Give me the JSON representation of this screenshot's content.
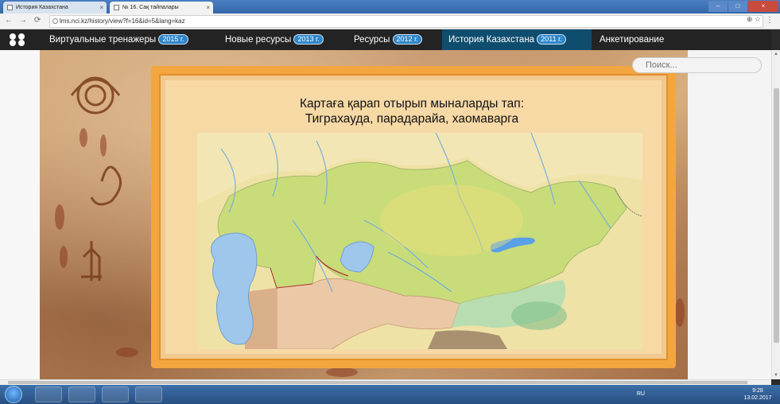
{
  "browser": {
    "tabs": [
      {
        "label": "История Казахстана",
        "active": false
      },
      {
        "label": "№ 16. Сақ тайпалары",
        "active": true
      }
    ],
    "url": "lms.nci.kz/history/view?f=16&id=5&lang=kaz"
  },
  "site_nav": {
    "items": [
      {
        "label": "Виртуальные тренажеры",
        "badge": "2015 г."
      },
      {
        "label": "Новые ресурсы",
        "badge": "2013 г."
      },
      {
        "label": "Ресурсы",
        "badge": "2012 г."
      },
      {
        "label": "История Казахстана",
        "badge": "2011 г.",
        "active": true
      },
      {
        "label": "Анкетирование",
        "badge": ""
      }
    ]
  },
  "search": {
    "placeholder": "Поиск..."
  },
  "lesson": {
    "prompt_line1": "Картаға қарап отырып мыналарды тап:",
    "prompt_line2": "Тигрaхауда, парадарайа, хаомаварга"
  },
  "taskbar": {
    "lang": "RU",
    "time": "9:28",
    "date": "13.02.2017"
  },
  "colors": {
    "navbar": "#232323",
    "nav_active": "#0f4d6e",
    "badge": "#2e86c9",
    "frame": "#f3a640",
    "map_kazakhstan": "#c8dc7a",
    "map_water": "#9fc7ec"
  }
}
